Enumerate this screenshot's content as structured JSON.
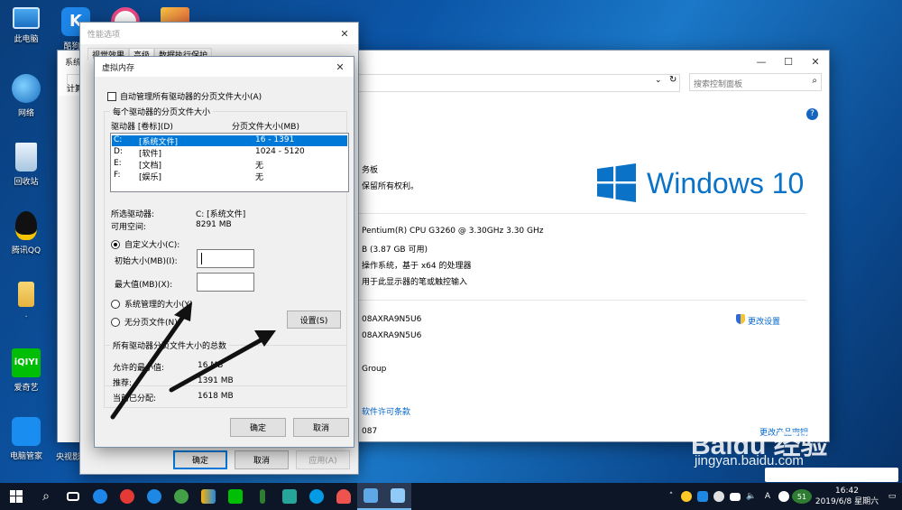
{
  "desktop": {
    "icons": [
      {
        "label": "此电脑"
      },
      {
        "label": "酷狗音"
      },
      {
        "label": "网络"
      },
      {
        "label": "回收站"
      },
      {
        "label": "腾讯QQ"
      },
      {
        "label": "."
      },
      {
        "label": "爱奇艺"
      },
      {
        "label": "电脑管家"
      },
      {
        "label": "央视影"
      }
    ]
  },
  "system_window": {
    "title": "系统",
    "search_placeholder": "搜索控制面板",
    "heading_partial": "计算",
    "win_logo_text": "Windows 10",
    "rows": {
      "panel": "务板",
      "rights": "保留所有权利。",
      "cpu": "Pentium(R) CPU G3260 @ 3.30GHz   3.30 GHz",
      "ram": "B (3.87 GB 可用)",
      "systype": "操作系统，基于 x64 的处理器",
      "pen": "用于此显示器的笔或触控输入",
      "comp1": "08AXRA9N5U6",
      "comp2": "08AXRA9N5U6",
      "workgroup": "Group",
      "change_settings": "更改设置",
      "license": "软件许可条款",
      "product": "087",
      "change_key": "更改产品密钥"
    }
  },
  "perf_window": {
    "title": "性能选项",
    "tabs": [
      "视觉效果",
      "高级",
      "数据执行保护"
    ],
    "ok": "确定",
    "cancel": "取消",
    "apply": "应用(A)"
  },
  "vm_dialog": {
    "title": "虚拟内存",
    "auto_manage": "自动管理所有驱动器的分页文件大小(A)",
    "group_title": "每个驱动器的分页文件大小",
    "col_drive": "驱动器 [卷标](D)",
    "col_size": "分页文件大小(MB)",
    "drives": [
      {
        "drive": "C:",
        "label": "[系统文件]",
        "size": "16 - 1391"
      },
      {
        "drive": "D:",
        "label": "[软件]",
        "size": "1024 - 5120"
      },
      {
        "drive": "E:",
        "label": "[文档]",
        "size": "无"
      },
      {
        "drive": "F:",
        "label": "[娱乐]",
        "size": "无"
      }
    ],
    "selected_drive_label": "所选驱动器:",
    "selected_drive_value": "C:  [系统文件]",
    "free_space_label": "可用空间:",
    "free_space_value": "8291 MB",
    "custom_size": "自定义大小(C):",
    "initial_size": "初始大小(MB)(I):",
    "max_size": "最大值(MB)(X):",
    "system_managed": "系统管理的大小(Y)",
    "no_paging": "无分页文件(N)",
    "set_button": "设置(S)",
    "total_group_title": "所有驱动器分页文件大小的总数",
    "min_allowed_label": "允许的最小值:",
    "min_allowed_value": "16 MB",
    "recommended_label": "推荐:",
    "recommended_value": "1391 MB",
    "allocated_label": "当前已分配:",
    "allocated_value": "1618 MB",
    "ok": "确定",
    "cancel": "取消"
  },
  "taskbar": {
    "time": "16:42",
    "date": "2019/6/8 星期六",
    "ime": "A",
    "tray_badge": "51"
  },
  "watermark": {
    "brand": "Baidu 经验",
    "url": "jingyan.baidu.com"
  },
  "colors": {
    "accent": "#0078d7",
    "selection": "#0078d7",
    "desktop": "#0c56a8"
  }
}
